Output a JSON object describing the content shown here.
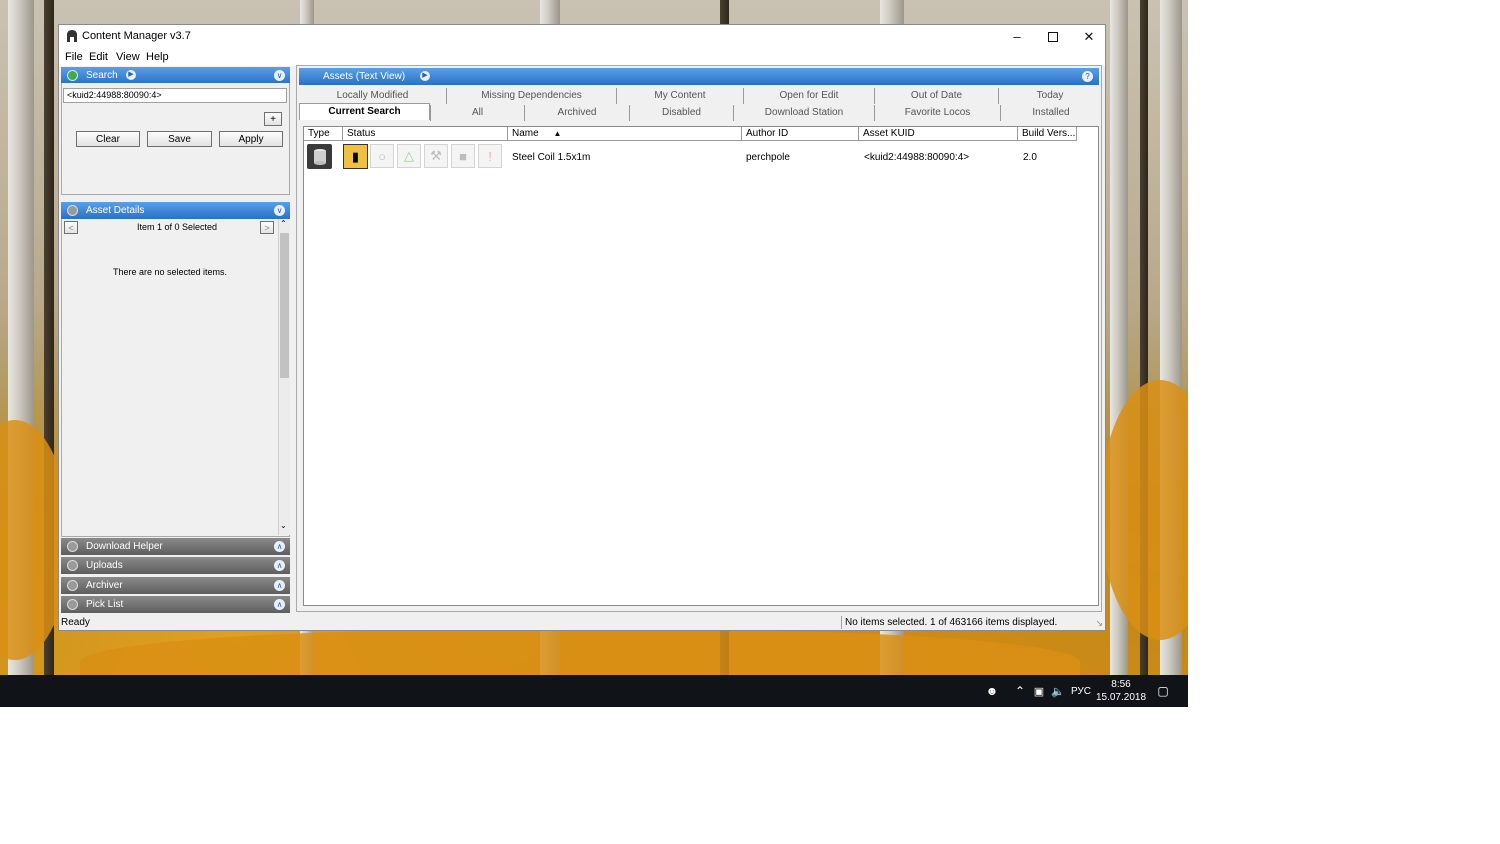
{
  "window": {
    "title": "Content Manager v3.7"
  },
  "menu": [
    "File",
    "Edit",
    "View",
    "Help"
  ],
  "search_panel": {
    "title": "Search",
    "query": "<kuid2:44988:80090:4>",
    "add_label": "+",
    "clear_label": "Clear",
    "save_label": "Save",
    "apply_label": "Apply"
  },
  "details_panel": {
    "title": "Asset Details",
    "prev_label": "<",
    "next_label": ">",
    "counter": "Item 1 of 0 Selected",
    "empty_message": "There are no selected items."
  },
  "collapsed_panels": [
    "Download Helper",
    "Uploads",
    "Archiver",
    "Pick List"
  ],
  "assets_pane": {
    "title": "Assets (Text View)",
    "help_label": "?",
    "tabs_top": [
      "Locally Modified",
      "Missing Dependencies",
      "My Content",
      "Open for Edit",
      "Out of Date",
      "Today"
    ],
    "tabs_bottom": [
      "Current Search",
      "All",
      "Archived",
      "Disabled",
      "Download Station",
      "Favorite Locos",
      "Installed"
    ],
    "active_tab": "Current Search",
    "columns": [
      "Type",
      "Status",
      "Name",
      "Author ID",
      "Asset KUID",
      "Build Vers..."
    ],
    "rows": [
      {
        "name": "Steel Coil 1.5x1m",
        "author": "perchpole",
        "kuid": "<kuid2:44988:80090:4>",
        "build": "2.0"
      }
    ]
  },
  "status": {
    "left": "Ready",
    "right": "No items selected. 1 of 463166 items displayed."
  },
  "taskbar": {
    "language": "РУС",
    "time": "8:56",
    "date": "15.07.2018"
  }
}
